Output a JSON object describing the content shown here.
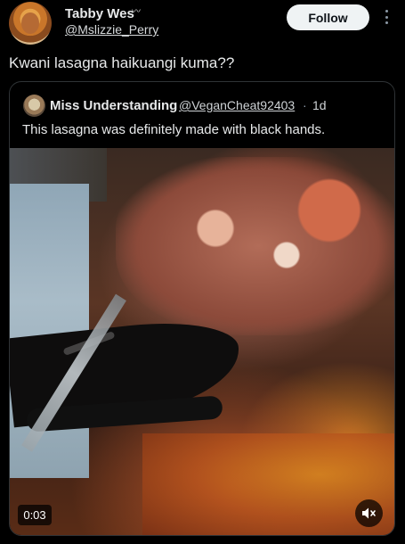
{
  "author": {
    "display_name": "Tabby Wes",
    "name_decoration": "〰",
    "handle": "@Mslizzie_Perry",
    "avatar_icon": "profile-avatar"
  },
  "actions": {
    "follow_label": "Follow",
    "more_icon": "more-vertical-icon"
  },
  "tweet": {
    "text": "Kwani lasagna haikuangi kuma??"
  },
  "quote": {
    "display_name": "Miss Understanding",
    "handle": "@VeganCheat92403",
    "separator": "·",
    "time": "1d",
    "text": "This lasagna was definitely made with black hands."
  },
  "media": {
    "type": "video",
    "duration": "0:03",
    "mute_icon": "speaker-muted-icon"
  },
  "colors": {
    "background": "#000000",
    "text": "#e7e9ea",
    "follow_bg": "#eff3f4",
    "border": "#2f3336"
  }
}
